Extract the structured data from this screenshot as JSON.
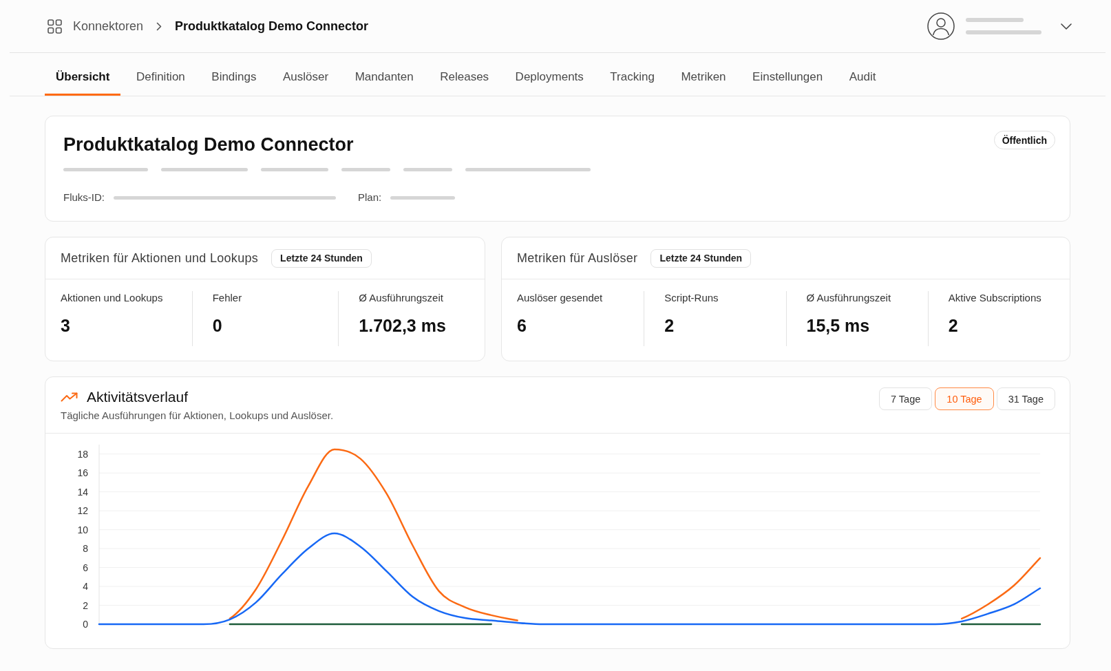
{
  "header": {
    "breadcrumb": [
      {
        "label": "Konnektoren",
        "current": false
      },
      {
        "label": "Produktkatalog Demo Connector",
        "current": true
      }
    ]
  },
  "tabs": [
    {
      "label": "Übersicht",
      "selected": true
    },
    {
      "label": "Definition",
      "selected": false
    },
    {
      "label": "Bindings",
      "selected": false
    },
    {
      "label": "Auslöser",
      "selected": false
    },
    {
      "label": "Mandanten",
      "selected": false
    },
    {
      "label": "Releases",
      "selected": false
    },
    {
      "label": "Deployments",
      "selected": false
    },
    {
      "label": "Tracking",
      "selected": false
    },
    {
      "label": "Metriken",
      "selected": false
    },
    {
      "label": "Einstellungen",
      "selected": false
    },
    {
      "label": "Audit",
      "selected": false
    }
  ],
  "connector": {
    "title": "Produktkatalog Demo Connector",
    "visibility": "Öffentlich",
    "fields": [
      {
        "label": "Fluks-ID:"
      },
      {
        "label": "Plan:"
      }
    ]
  },
  "metric_panels": [
    {
      "title": "Metriken für Aktionen und Lookups",
      "period": "Letzte 24 Stunden",
      "stats": [
        {
          "label": "Aktionen und Lookups",
          "value": "3"
        },
        {
          "label": "Fehler",
          "value": "0"
        },
        {
          "label": "Ø Ausführungszeit",
          "value": "1.702,3 ms"
        }
      ]
    },
    {
      "title": "Metriken für Auslöser",
      "period": "Letzte 24 Stunden",
      "stats": [
        {
          "label": "Auslöser gesendet",
          "value": "6"
        },
        {
          "label": "Script-Runs",
          "value": "2"
        },
        {
          "label": "Ø Ausführungszeit",
          "value": "15,5 ms"
        },
        {
          "label": "Aktive Subscriptions",
          "value": "2"
        }
      ]
    }
  ],
  "activity": {
    "title": "Aktivitätsverlauf",
    "subtitle": "Tägliche Ausführungen für Aktionen, Lookups und Auslöser.",
    "ranges": [
      {
        "label": "7 Tage",
        "selected": false
      },
      {
        "label": "10 Tage",
        "selected": true
      },
      {
        "label": "31 Tage",
        "selected": false
      }
    ],
    "chart_data": {
      "type": "line",
      "ylim": [
        0,
        19
      ],
      "yticks": [
        0,
        2,
        4,
        6,
        8,
        10,
        12,
        14,
        16,
        18
      ],
      "grid": true,
      "series": [
        {
          "color": "#1d5c3a",
          "values": [
            null,
            null,
            null,
            null,
            null,
            0,
            0,
            0,
            0,
            0,
            0,
            0,
            0,
            0,
            0,
            0,
            null,
            null,
            null,
            null,
            null,
            null,
            null,
            null,
            null,
            null,
            null,
            null,
            null,
            null,
            null,
            null,
            null,
            0,
            0,
            0,
            0
          ]
        },
        {
          "color": "#fb6a14",
          "values": [
            null,
            null,
            null,
            null,
            null,
            0.6,
            3.7,
            8.9,
            14.6,
            18.5,
            17.5,
            13.8,
            8.3,
            3.5,
            1.8,
            0.95,
            0.4,
            null,
            null,
            null,
            null,
            null,
            null,
            null,
            null,
            null,
            null,
            null,
            null,
            null,
            null,
            null,
            null,
            0.6,
            2.1,
            4.1,
            7.0
          ]
        },
        {
          "color": "#1768f5",
          "values": [
            0,
            0,
            0,
            0,
            0,
            0.5,
            2.3,
            5.3,
            8.0,
            9.6,
            8.2,
            5.6,
            2.9,
            1.4,
            0.65,
            0.4,
            0.15,
            0,
            0,
            0,
            0,
            0,
            0,
            0,
            0,
            0,
            0,
            0,
            0,
            0,
            0,
            0,
            0,
            0.3,
            1.1,
            2.1,
            3.8
          ]
        }
      ]
    }
  }
}
